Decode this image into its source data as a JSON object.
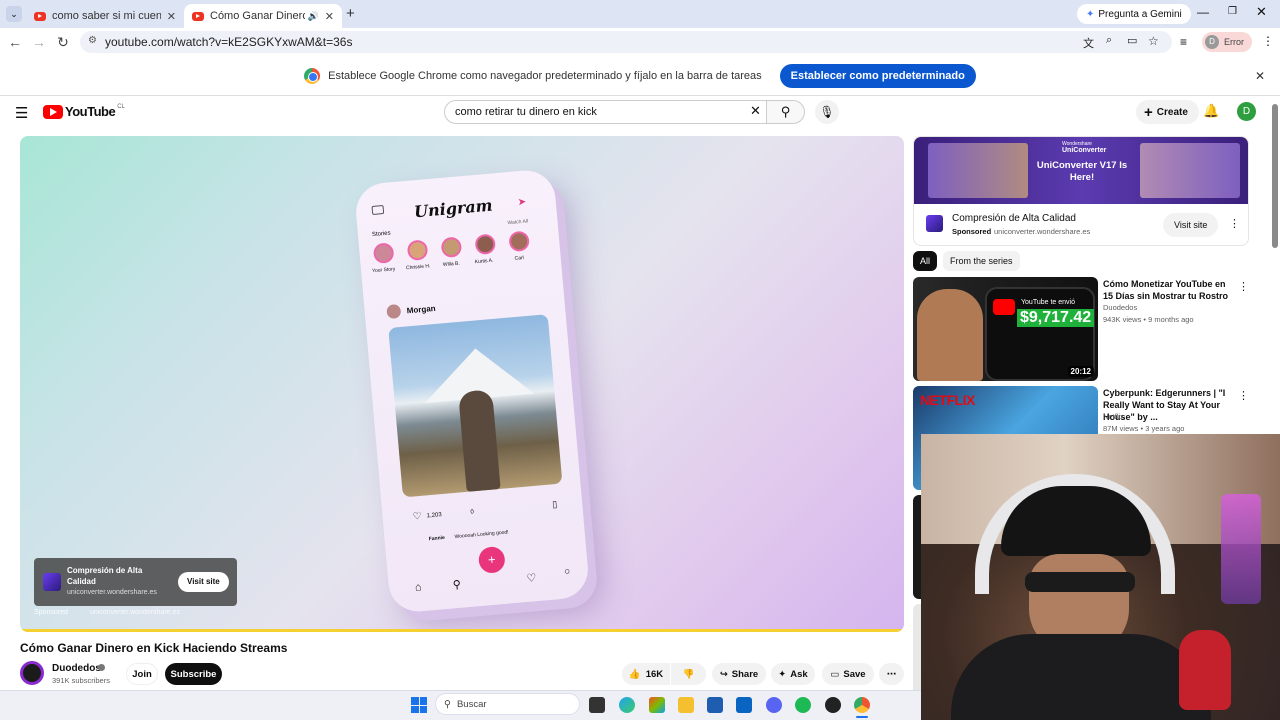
{
  "browser": {
    "tabs": [
      {
        "label": "como saber si mi cuenta corrien",
        "close": "✕"
      },
      {
        "label": "Cómo Ganar Dinero en Kick",
        "close": "✕"
      }
    ],
    "new_tab": "+",
    "gemini": "Pregunta a Gemini",
    "url": "youtube.com/watch?v=kE2SGKYxwAM&t=36s",
    "profile_initial": "D",
    "profile_status": "Error",
    "infobar_text": "Establece Google Chrome como navegador predeterminado y fíjalo en la barra de tareas",
    "infobar_button": "Establecer como predeterminado"
  },
  "youtube": {
    "logo": "YouTube",
    "region": "CL",
    "search_query": "como retirar tu dinero en kick",
    "create": "Create",
    "avatar_initial": "D"
  },
  "video": {
    "phone_app": "Unigram",
    "stories_label": "Stories",
    "watch_all": "Watch All",
    "story_names": [
      "Your Story",
      "Chrissie H.",
      "Willa B.",
      "Kurtis A.",
      "Carl"
    ],
    "post_user": "Morgan",
    "likes": "1,203",
    "comments": "0",
    "comment_user": "Fannie",
    "comment_text": "Wooooah Looking good!",
    "ad_title": "Compresión de Alta Calidad",
    "ad_domain": "uniconverter.wondershare.es",
    "ad_button": "Visit site",
    "sponsored": "Sponsored",
    "title": "Cómo Ganar Dinero en Kick Haciendo Streams",
    "channel": "Duodedos",
    "subscribers": "391K subscribers",
    "join": "Join",
    "subscribe": "Subscribe",
    "likes_count": "16K",
    "share": "Share",
    "ask": "Ask",
    "save": "Save"
  },
  "side_ad": {
    "brand_small": "Wondershare",
    "brand": "UniConverter",
    "headline": "UniConverter V17 Is Here!",
    "title": "Compresión de Alta Calidad",
    "sponsored": "Sponsored",
    "domain": "uniconverter.wondershare.es",
    "button": "Visit site"
  },
  "chips": [
    "All",
    "From the series"
  ],
  "related": [
    {
      "title": "Cómo Monetizar YouTube en 15 Días sin Mostrar tu Rostro",
      "channel": "Duodedos",
      "meta": "943K views • 9 months ago",
      "duration": "20:12",
      "thumb_label": "YouTube te envió",
      "thumb_amount": "$9,717.42"
    },
    {
      "title": "Cyberpunk: Edgerunners | \"I Really Want to Stay At Your House\" by ...",
      "channel": "Netflix",
      "meta": "87M views • 3 years ago",
      "thumb_label": "NETFLIX"
    }
  ],
  "taskbar": {
    "search_placeholder": "Buscar"
  }
}
